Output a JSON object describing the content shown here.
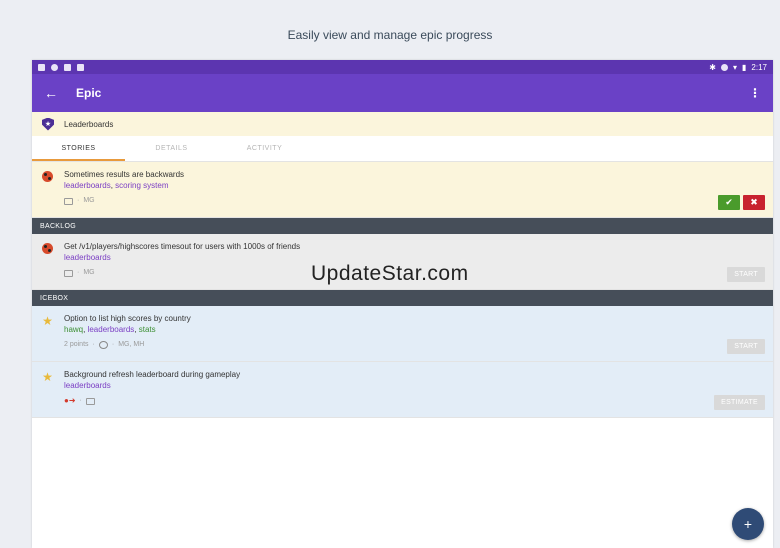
{
  "caption": "Easily view and manage epic progress",
  "statusbar": {
    "time": "2:17"
  },
  "appbar": {
    "back_icon": "arrow-left-icon",
    "title": "Epic",
    "more_icon": "more-vertical-icon"
  },
  "epic": {
    "name": "Leaderboards"
  },
  "tabs": [
    {
      "label": "STORIES",
      "active": true
    },
    {
      "label": "DETAILS",
      "active": false
    },
    {
      "label": "ACTIVITY",
      "active": false
    }
  ],
  "accepted_story": {
    "title": "Sometimes results are backwards",
    "labels": [
      "leaderboards",
      "scoring system"
    ],
    "owners": "MG"
  },
  "backlog": {
    "header": "BACKLOG",
    "story": {
      "title": "Get /v1/players/highscores timesout for users with 1000s of friends",
      "labels": [
        "leaderboards"
      ],
      "owners": "MG",
      "action": "START"
    }
  },
  "icebox": {
    "header": "ICEBOX",
    "stories": [
      {
        "title": "Option to list high scores by country",
        "labels": [
          "hawq",
          "leaderboards",
          "stats"
        ],
        "points": "2 points",
        "owners": "MG, MH",
        "action": "START"
      },
      {
        "title": "Background refresh leaderboard during gameplay",
        "labels": [
          "leaderboards"
        ],
        "action": "ESTIMATE"
      }
    ]
  },
  "watermark": "UpdateStar.com",
  "colors": {
    "appbar": "#6a41c6",
    "statusbar": "#5c35b0",
    "label": "#7b3fc4",
    "accept": "#4a9b2c",
    "reject": "#c8222f",
    "fab": "#2f4b76"
  }
}
